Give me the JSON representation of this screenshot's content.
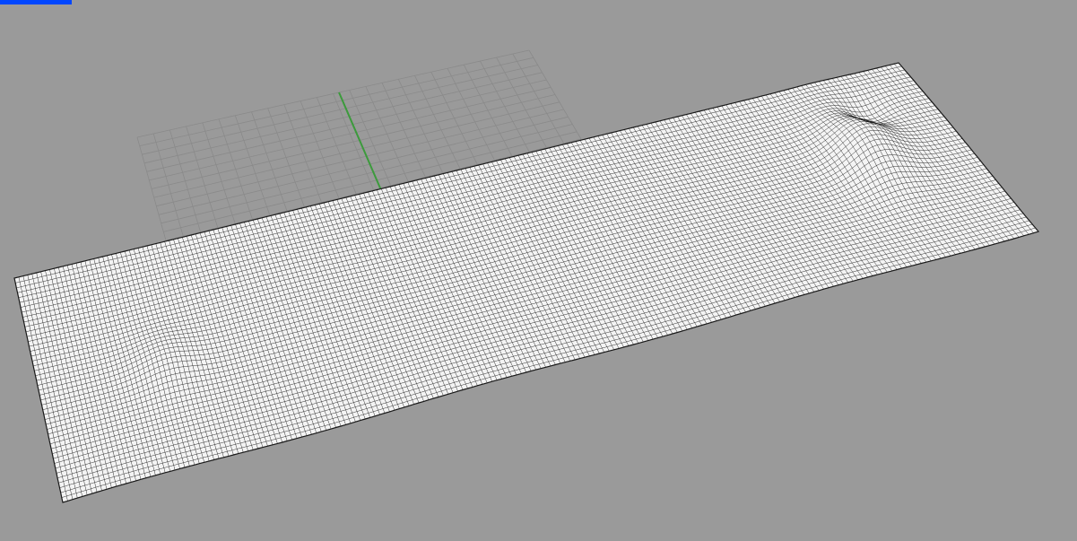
{
  "viewport": {
    "label": "",
    "background": "#9a9a9a",
    "tab_color": "#0046ff",
    "grid_color": "#8a8a8a",
    "grid_axis_color": "#3c9a3c",
    "mesh_fill": "#f4f4f4",
    "mesh_line": "#1a1a1a"
  }
}
